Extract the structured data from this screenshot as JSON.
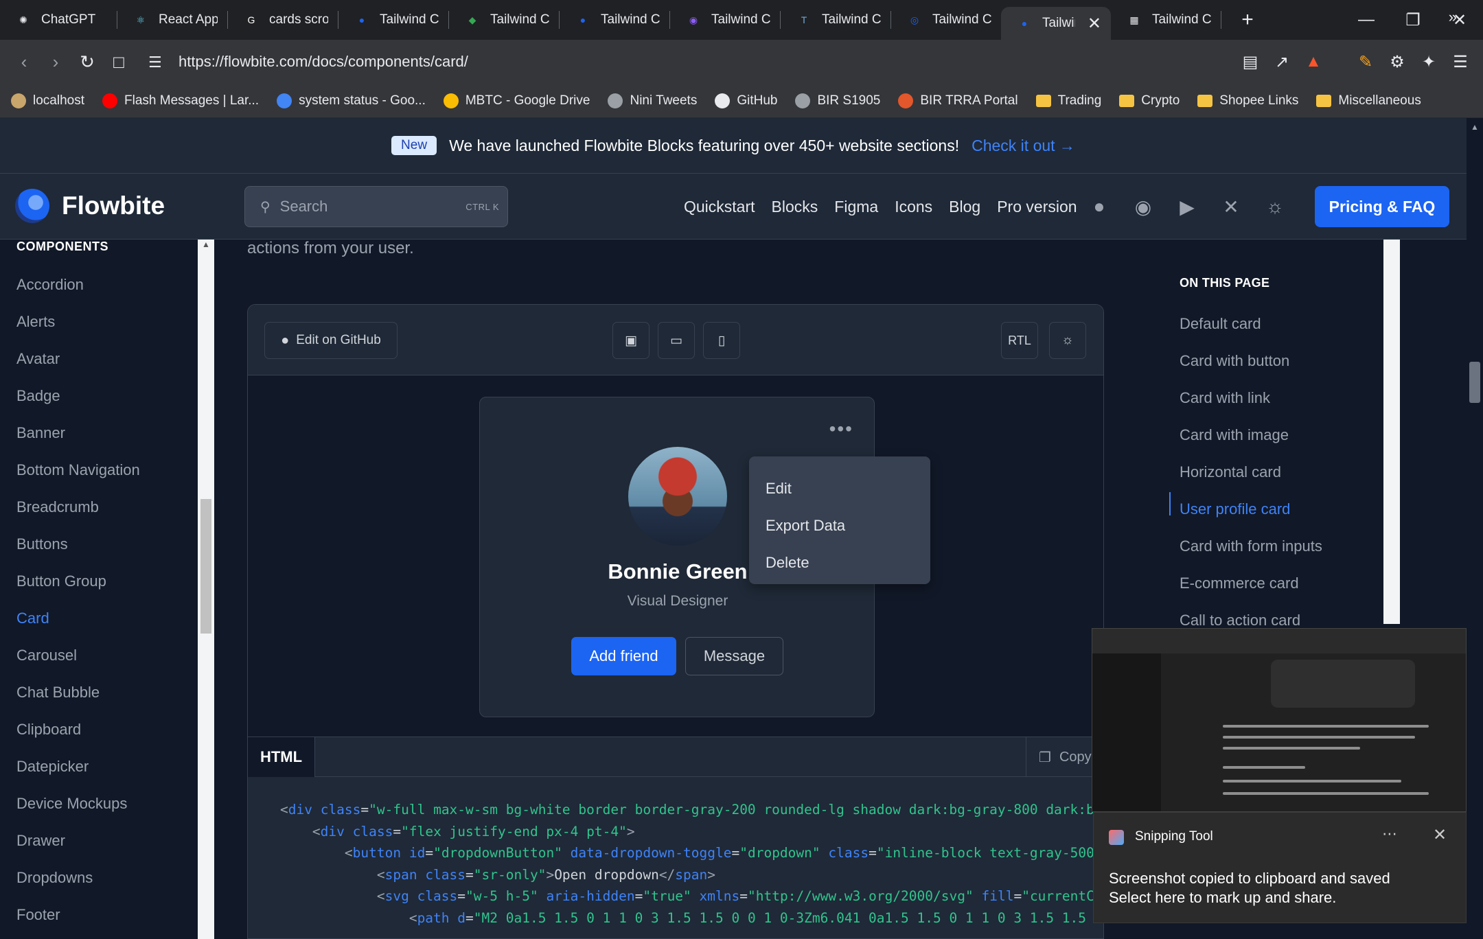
{
  "browser": {
    "tabs": [
      {
        "title": "ChatGPT",
        "icon": "chatgpt-icon",
        "color": "#e8eaed"
      },
      {
        "title": "React App",
        "icon": "react-icon",
        "color": "#61dafb"
      },
      {
        "title": "cards scroll",
        "icon": "google-icon",
        "color": "#ffffff"
      },
      {
        "title": "Tailwind CS",
        "icon": "flowbite-icon",
        "color": "#1c64f2"
      },
      {
        "title": "Tailwind Car",
        "icon": "ai-icon",
        "color": "#34a853"
      },
      {
        "title": "Tailwind CS",
        "icon": "flowbite-icon",
        "color": "#1c64f2"
      },
      {
        "title": "Tailwind CS",
        "icon": "chat-icon",
        "color": "#8b5cf6"
      },
      {
        "title": "Tailwind CS",
        "icon": "t-icon",
        "color": "#6fa8dc"
      },
      {
        "title": "Tailwind CS",
        "icon": "swirl-icon",
        "color": "#1c64f2"
      },
      {
        "title": "Tailwin",
        "icon": "flowbite-icon",
        "color": "#1c64f2",
        "active": true
      },
      {
        "title": "Tailwind CS",
        "icon": "grid-icon",
        "color": "#e8eaed"
      }
    ],
    "new_tab": "+",
    "url": "https://flowbite.com/docs/components/card/",
    "bookmarks": [
      {
        "label": "localhost",
        "icon": "laravel-icon",
        "color": "#c9a66b"
      },
      {
        "label": "Flash Messages | Lar...",
        "icon": "youtube-icon",
        "color": "#ff0000"
      },
      {
        "label": "system status - Goo...",
        "icon": "docs-icon",
        "color": "#4285f4"
      },
      {
        "label": "MBTC - Google Drive",
        "icon": "drive-icon",
        "color": "#fbbc04"
      },
      {
        "label": "Nini Tweets",
        "icon": "globe-icon",
        "color": "#9aa0a6"
      },
      {
        "label": "GitHub",
        "icon": "github-icon",
        "color": "#e8eaed"
      },
      {
        "label": "BIR S1905",
        "icon": "globe-icon",
        "color": "#9aa0a6"
      },
      {
        "label": "BIR TRRA Portal",
        "icon": "bir-icon",
        "color": "#e2572b"
      },
      {
        "label": "Trading",
        "icon": "folder-icon",
        "color": "#f6c443"
      },
      {
        "label": "Crypto",
        "icon": "folder-icon",
        "color": "#f6c443"
      },
      {
        "label": "Shopee Links",
        "icon": "folder-icon",
        "color": "#f6c443"
      },
      {
        "label": "Miscellaneous",
        "icon": "folder-icon",
        "color": "#f6c443"
      }
    ]
  },
  "banner": {
    "badge": "New",
    "text": "We have launched Flowbite Blocks featuring over 450+ website sections!",
    "link": "Check it out →"
  },
  "nav": {
    "brand": "Flowbite",
    "search_placeholder": "Search",
    "search_shortcut": "CTRL K",
    "links": [
      "Quickstart",
      "Blocks",
      "Figma",
      "Icons",
      "Blog",
      "Pro version"
    ],
    "cta": "Pricing & FAQ"
  },
  "sidebar": {
    "heading": "COMPONENTS",
    "items": [
      "Accordion",
      "Alerts",
      "Avatar",
      "Badge",
      "Banner",
      "Bottom Navigation",
      "Breadcrumb",
      "Buttons",
      "Button Group",
      "Card",
      "Carousel",
      "Chat Bubble",
      "Clipboard",
      "Datepicker",
      "Device Mockups",
      "Drawer",
      "Dropdowns",
      "Footer"
    ],
    "active": "Card"
  },
  "main": {
    "intro": "actions from your user.",
    "toolbar": {
      "github": "Edit on GitHub",
      "rtl": "RTL"
    },
    "card": {
      "name": "Bonnie Green",
      "role": "Visual Designer",
      "primary": "Add friend",
      "secondary": "Message"
    },
    "dropdown": [
      "Edit",
      "Export Data",
      "Delete"
    ],
    "code_tab": "HTML",
    "copy": "Copy"
  },
  "toc": {
    "heading": "ON THIS PAGE",
    "items": [
      "Default card",
      "Card with button",
      "Card with link",
      "Card with image",
      "Horizontal card",
      "User profile card",
      "Card with form inputs",
      "E-commerce card",
      "Call to action card"
    ],
    "active": "User profile card"
  },
  "toast": {
    "app": "Snipping Tool",
    "line1": "Screenshot copied to clipboard and saved",
    "line2": "Select here to mark up and share."
  },
  "colors": {
    "accent": "#1c64f2",
    "link": "#3f83f8",
    "page_bg": "#111827",
    "panel_bg": "#1f2937"
  }
}
